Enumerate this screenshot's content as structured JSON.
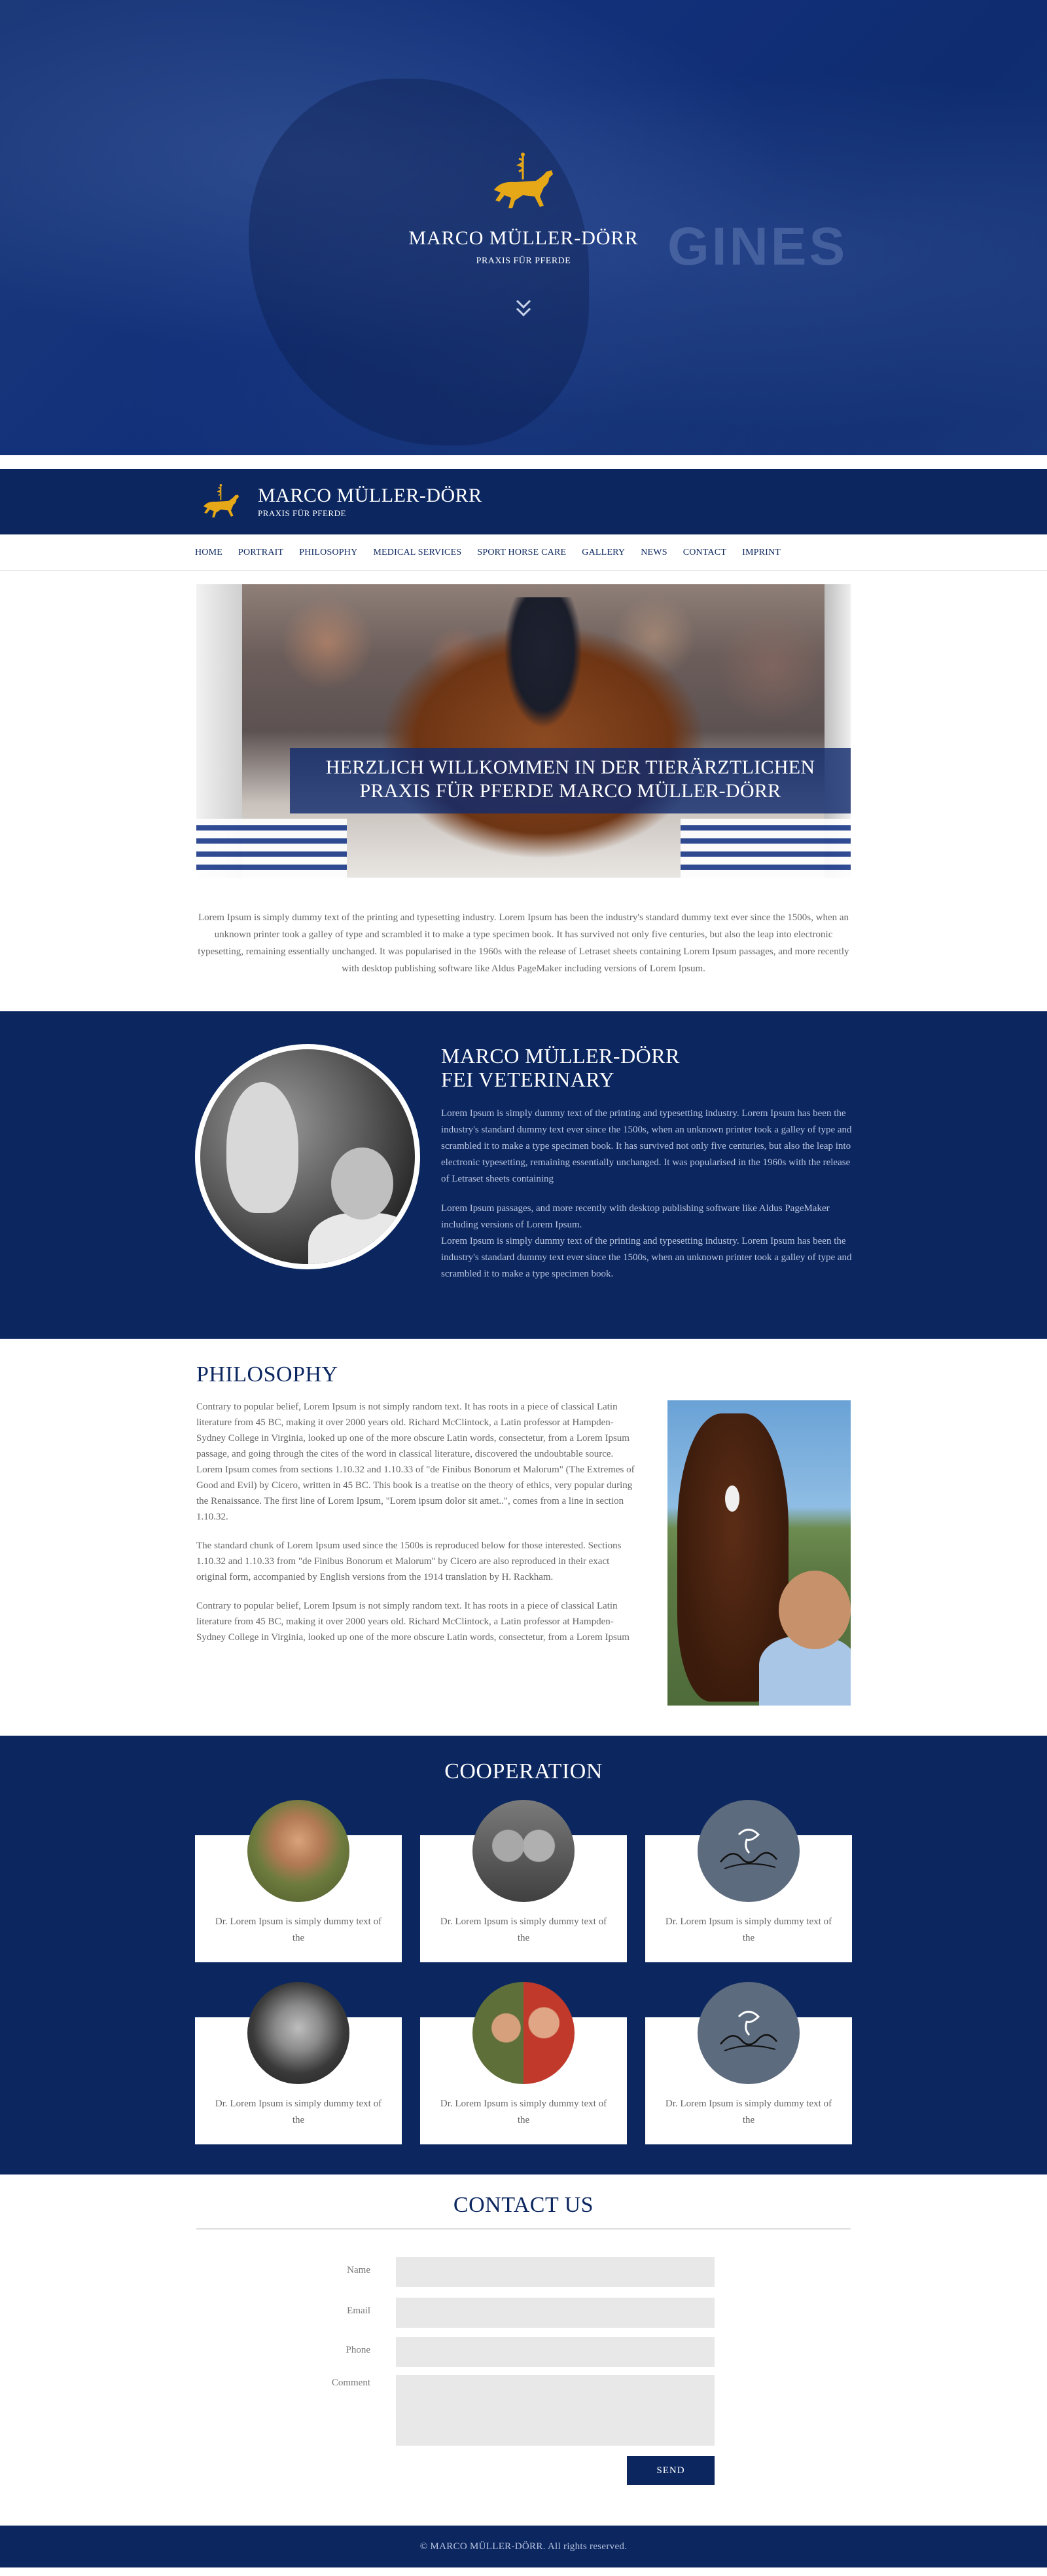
{
  "colors": {
    "navy": "#0c2760",
    "gold": "#e6a817",
    "white": "#ffffff",
    "input_gray": "#e8e8e8"
  },
  "hero": {
    "title": "MARCO MÜLLER-DÖRR",
    "subtitle": "PRAXIS FÜR PFERDE",
    "logo_icon": "golden-horse-logo-icon",
    "scroll_icon": "double-chevron-down-icon"
  },
  "header": {
    "title": "MARCO MÜLLER-DÖRR",
    "subtitle": "PRAXIS FÜR PFERDE",
    "logo_icon": "golden-horse-logo-icon"
  },
  "nav": {
    "items": [
      {
        "label": "HOME"
      },
      {
        "label": "PORTRAIT"
      },
      {
        "label": "PHILOSOPHY"
      },
      {
        "label": "MEDICAL SERVICES"
      },
      {
        "label": "SPORT HORSE CARE"
      },
      {
        "label": "GALLERY"
      },
      {
        "label": "NEWS"
      },
      {
        "label": "CONTACT"
      },
      {
        "label": "IMPRINT"
      }
    ]
  },
  "welcome": {
    "caption": "HERZLICH WILLKOMMEN IN DER TIERÄRZTLICHEN PRAXIS FÜR PFERDE MARCO MÜLLER-DÖRR",
    "intro": "Lorem Ipsum is simply dummy text of the printing and typesetting industry. Lorem Ipsum has been the industry's standard dummy text ever since the 1500s, when an unknown printer took a galley of type and scrambled it to make a type specimen book. It has survived not only five centuries, but also the leap into electronic typesetting, remaining essentially unchanged. It was popularised in the 1960s with the release of Letraset sheets containing Lorem Ipsum passages, and more recently with desktop publishing software like Aldus PageMaker including versions of Lorem Ipsum."
  },
  "vet": {
    "title_line1": "MARCO MÜLLER-DÖRR",
    "title_line2": "FEI VETERINARY",
    "paragraph1": "Lorem Ipsum is simply dummy text of the printing and typesetting industry. Lorem Ipsum has been the industry's standard dummy text ever since the 1500s, when an unknown printer took a galley of type and scrambled it to make a type specimen book. It has survived not only five centuries, but also the leap into electronic typesetting, remaining essentially unchanged. It was popularised in the 1960s with the release of Letraset sheets containing",
    "paragraph2": "Lorem Ipsum passages, and more recently with desktop publishing software like Aldus PageMaker including versions of Lorem Ipsum.",
    "paragraph3": "Lorem Ipsum is simply dummy text of the printing and typesetting industry. Lorem Ipsum has been the industry's standard dummy text ever since the 1500s, when an unknown printer took a galley of type and scrambled it to make a type specimen book."
  },
  "philosophy": {
    "title": "PHILOSOPHY",
    "paragraph1": "Contrary to popular belief, Lorem Ipsum is not simply random text. It has roots in a piece of classical Latin literature from 45 BC, making it over 2000 years old. Richard McClintock, a Latin professor at Hampden-Sydney College in Virginia, looked up one of the more obscure Latin words, consectetur, from a Lorem Ipsum passage, and going through the cites of the word in classical literature, discovered the undoubtable source. Lorem Ipsum comes from sections 1.10.32 and 1.10.33 of \"de Finibus Bonorum et Malorum\" (The Extremes of Good and Evil) by Cicero, written in 45 BC. This book is a treatise on the theory of ethics, very popular during the Renaissance. The first line of Lorem Ipsum, \"Lorem ipsum dolor sit amet..\", comes from a line in section 1.10.32.",
    "paragraph2": "The standard chunk of Lorem Ipsum used since the 1500s is reproduced below for those interested. Sections 1.10.32 and 1.10.33 from \"de Finibus Bonorum et Malorum\" by Cicero are also reproduced in their exact original form, accompanied by English versions from the 1914 translation by H. Rackham.",
    "paragraph3": "Contrary to popular belief, Lorem Ipsum is not simply random text. It has roots in a piece of classical Latin literature from 45 BC, making it over 2000 years old. Richard McClintock, a Latin professor at Hampden-Sydney College in Virginia, looked up one of the more obscure Latin words, consectetur, from a Lorem Ipsum"
  },
  "cooperation": {
    "title": "COOPERATION",
    "cards": [
      {
        "text": "Dr. Lorem Ipsum is simply dummy text of the",
        "avatar": "partner-portrait-1"
      },
      {
        "text": "Dr. Lorem Ipsum is simply dummy text of the",
        "avatar": "partner-portrait-2"
      },
      {
        "text": "Dr. Lorem Ipsum is simply dummy text of the",
        "avatar": "partner-logo-1"
      },
      {
        "text": "Dr. Lorem Ipsum is simply dummy text of the",
        "avatar": "partner-portrait-3"
      },
      {
        "text": "Dr. Lorem Ipsum is simply dummy text of the",
        "avatar": "partner-portrait-4"
      },
      {
        "text": "Dr. Lorem Ipsum is simply dummy text of the",
        "avatar": "partner-logo-2"
      }
    ]
  },
  "contact": {
    "title": "CONTACT US",
    "fields": {
      "name_label": "Name",
      "email_label": "Email",
      "phone_label": "Phone",
      "comment_label": "Comment"
    },
    "send_label": "SEND"
  },
  "footer": {
    "text": "© MARCO MÜLLER-DÖRR. All rights reserved."
  }
}
